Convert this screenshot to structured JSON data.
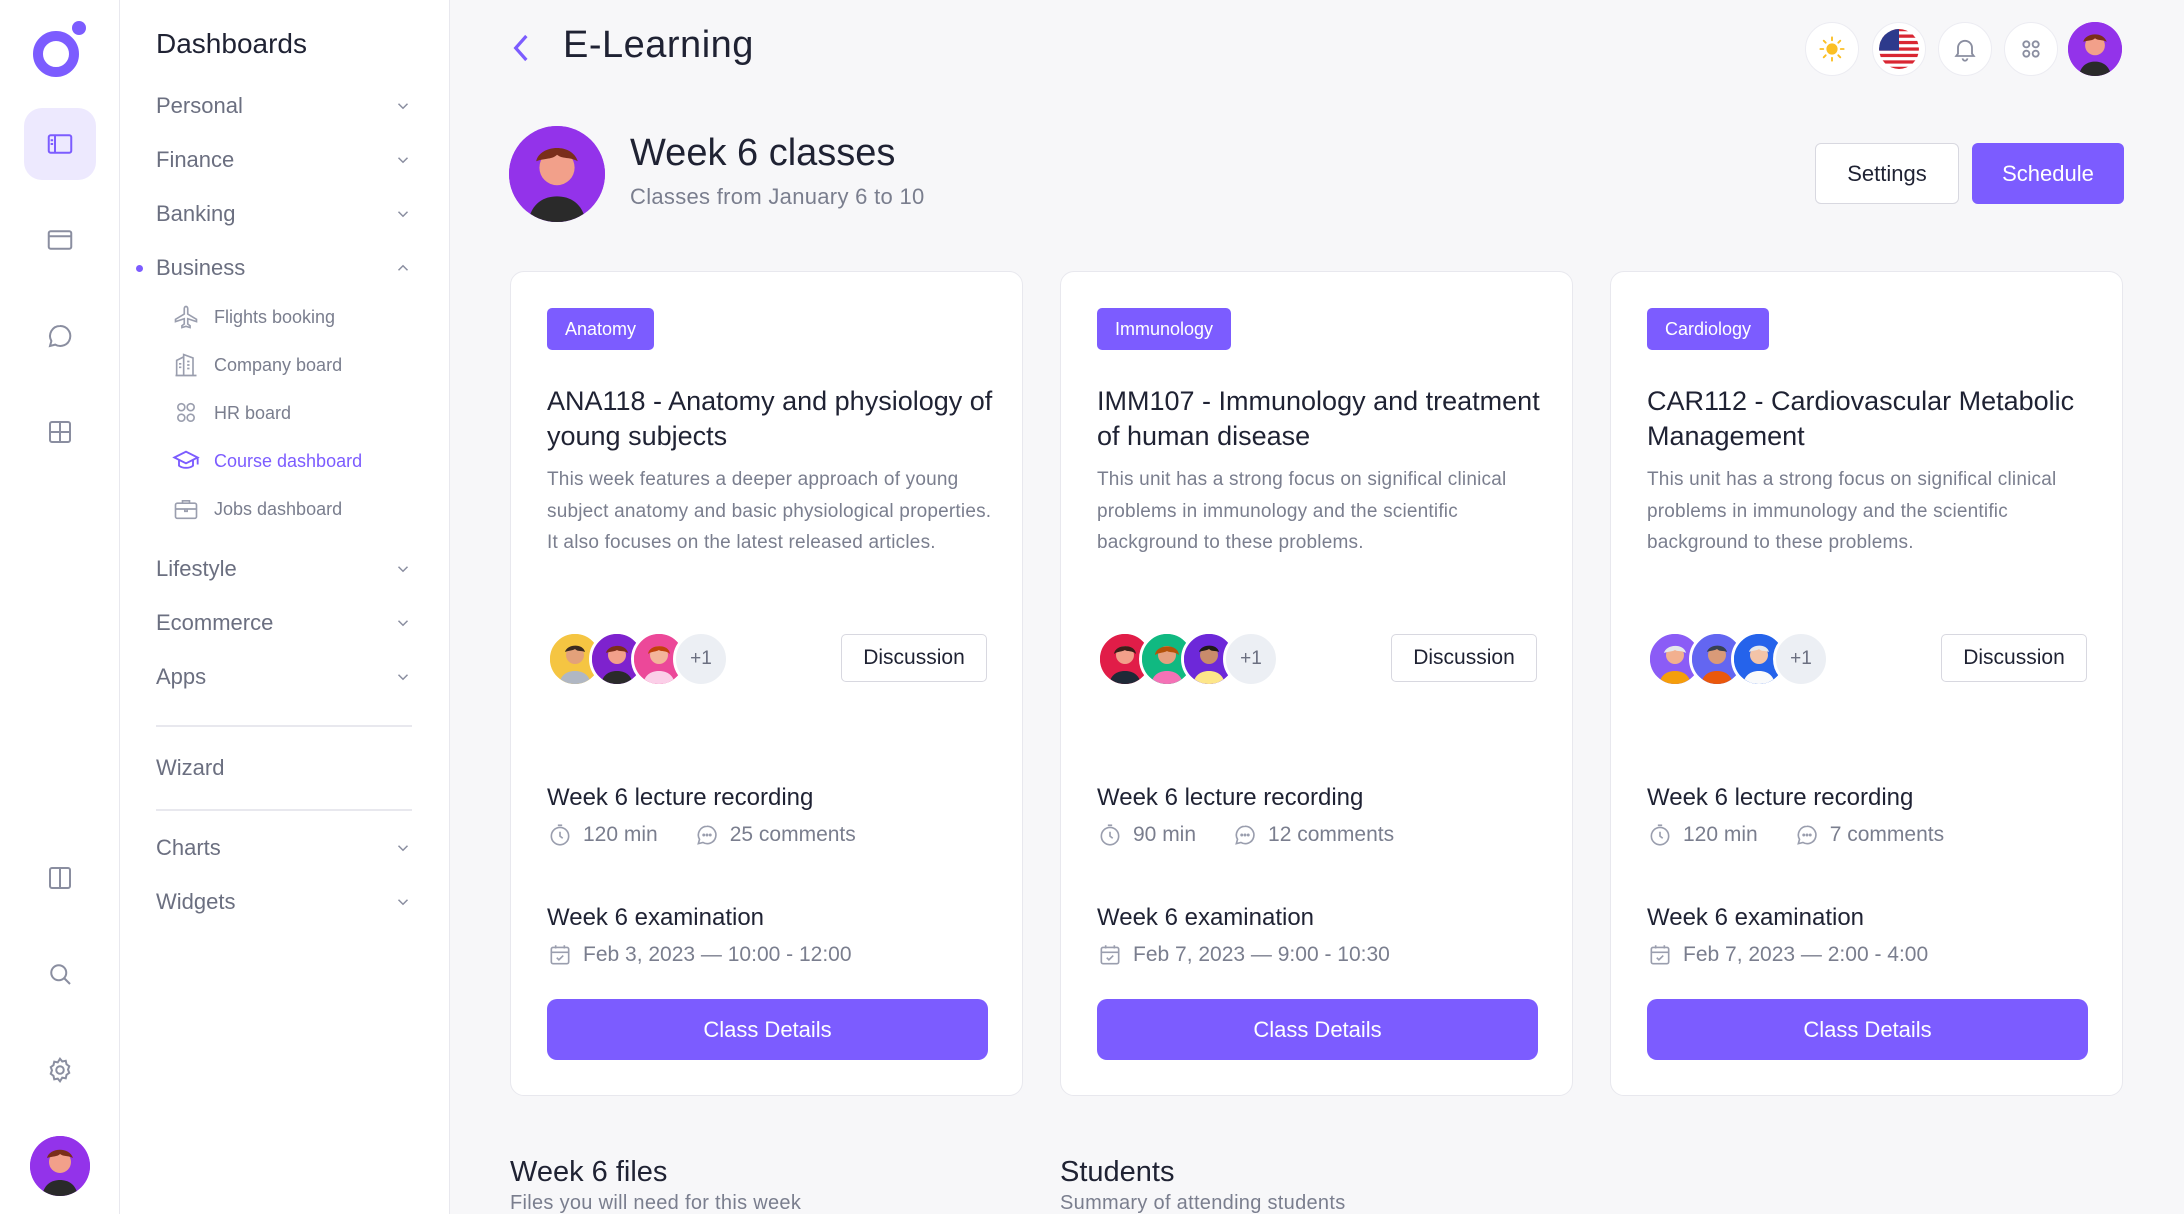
{
  "app": {
    "accent": "#7c5cff",
    "brand": "#7c5cff"
  },
  "rail": {
    "items": [
      {
        "name": "dashboards",
        "icon": "sidebar-layout-icon",
        "active": true
      },
      {
        "name": "layouts",
        "icon": "window-icon"
      },
      {
        "name": "messages",
        "icon": "chat-bubble-icon"
      },
      {
        "name": "components",
        "icon": "grid-icon"
      },
      {
        "name": "panel",
        "icon": "columns-icon"
      },
      {
        "name": "search",
        "icon": "search-icon"
      },
      {
        "name": "settings",
        "icon": "gear-icon"
      }
    ]
  },
  "nav": {
    "title": "Dashboards",
    "groups_top": [
      {
        "label": "Personal"
      },
      {
        "label": "Finance"
      },
      {
        "label": "Banking"
      },
      {
        "label": "Business",
        "expanded": true
      }
    ],
    "business_items": [
      {
        "label": "Flights booking",
        "icon": "plane-icon"
      },
      {
        "label": "Company board",
        "icon": "building-icon"
      },
      {
        "label": "HR board",
        "icon": "users-icon"
      },
      {
        "label": "Course dashboard",
        "icon": "graduation-cap-icon",
        "active": true
      },
      {
        "label": "Jobs dashboard",
        "icon": "briefcase-icon"
      }
    ],
    "groups_bottom": [
      {
        "label": "Lifestyle"
      },
      {
        "label": "Ecommerce"
      },
      {
        "label": "Apps"
      }
    ],
    "wizard": "Wizard",
    "groups_extra": [
      {
        "label": "Charts"
      },
      {
        "label": "Widgets"
      }
    ]
  },
  "header": {
    "title": "E-Learning",
    "buttons": [
      "sun-icon",
      "us-flag-icon",
      "bell-icon",
      "apps-grid-icon"
    ]
  },
  "week": {
    "title": "Week 6 classes",
    "subtitle": "Classes from January 6 to 10",
    "settings_label": "Settings",
    "schedule_label": "Schedule"
  },
  "cards": [
    {
      "tag": "Anatomy",
      "title": "ANA118 - Anatomy and physiology of young subjects",
      "description": "This week features a deeper approach of young subject anatomy and basic physiological properties. It also focuses on the latest released articles.",
      "extra_attendees": "+1",
      "discussion_label": "Discussion",
      "recording_title": "Week 6 lecture recording",
      "duration": "120 min",
      "comments": "25 comments",
      "exam_title": "Week 6 examination",
      "exam_date": "Feb 3, 2023 — 10:00 - 12:00",
      "details_label": "Class Details"
    },
    {
      "tag": "Immunology",
      "title": "IMM107 - Immunology and treatment of human disease",
      "description": "This unit has a strong focus on significal clinical problems in immunology and the scientific background to these problems.",
      "extra_attendees": "+1",
      "discussion_label": "Discussion",
      "recording_title": "Week 6 lecture recording",
      "duration": "90 min",
      "comments": "12 comments",
      "exam_title": "Week 6 examination",
      "exam_date": "Feb 7, 2023 — 9:00 - 10:30",
      "details_label": "Class Details"
    },
    {
      "tag": "Cardiology",
      "title": "CAR112 - Cardiovascular Metabolic Management",
      "description": "This unit has a strong focus on significal clinical problems in immunology and the scientific background to these problems.",
      "extra_attendees": "+1",
      "discussion_label": "Discussion",
      "recording_title": "Week 6 lecture recording",
      "duration": "120 min",
      "comments": "7 comments",
      "exam_title": "Week 6 examination",
      "exam_date": "Feb 7, 2023 — 2:00 - 4:00",
      "details_label": "Class Details"
    }
  ],
  "files": {
    "title": "Week 6 files",
    "subtitle": "Files you will need for this week"
  },
  "students": {
    "title": "Students",
    "subtitle": "Summary of attending students"
  }
}
